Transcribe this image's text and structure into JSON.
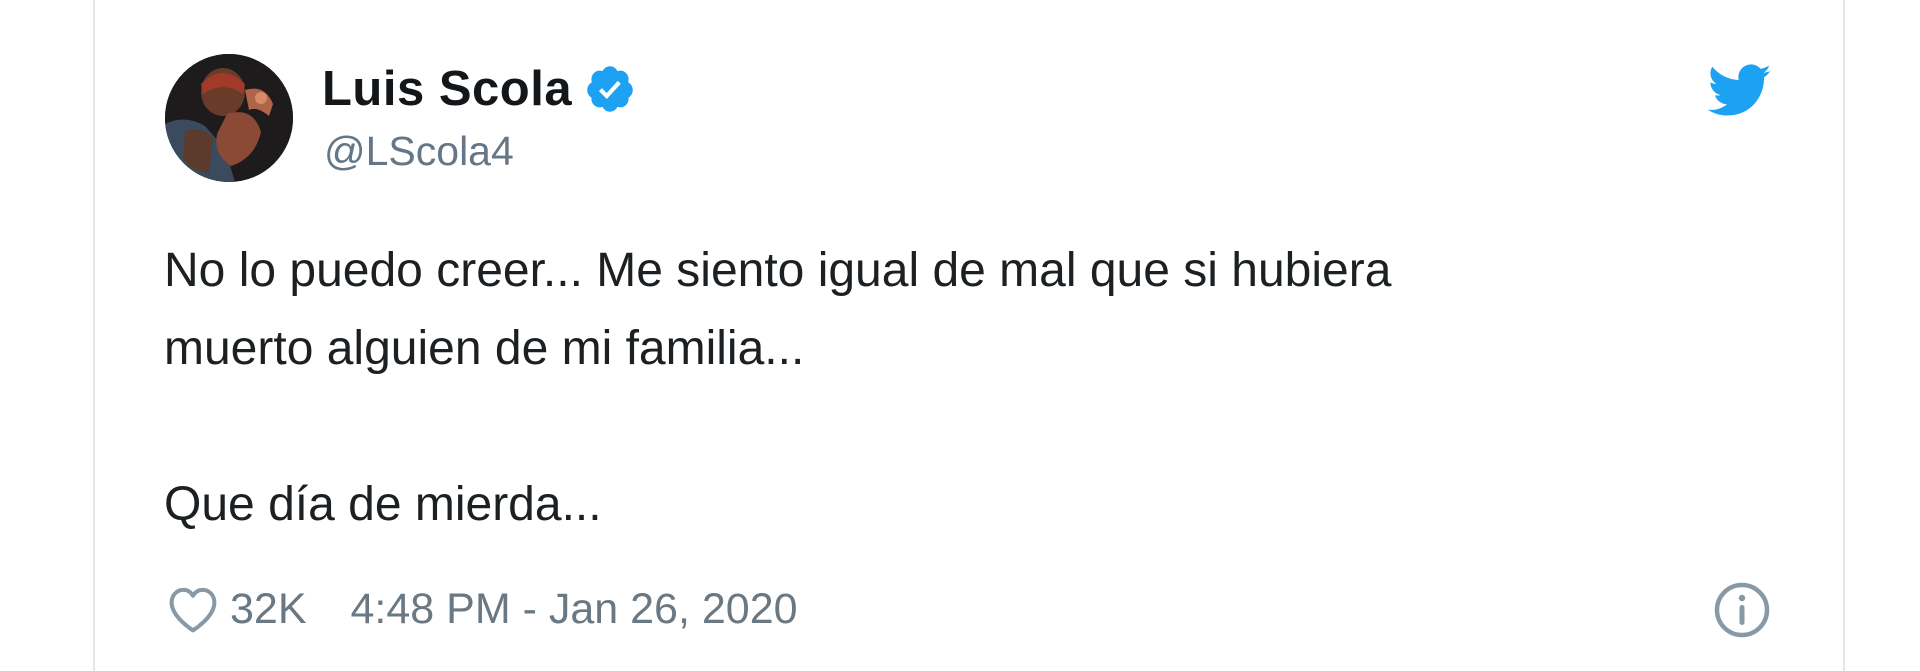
{
  "tweet": {
    "author": {
      "display_name": "Luis Scola",
      "handle": "@LScola4",
      "verified": true
    },
    "text_lines": [
      "No lo puedo creer... Me siento igual de mal que si hubiera",
      "muerto alguien de mi familia..."
    ],
    "text_line_last": "Que día de mierda...",
    "likes": "32K",
    "timestamp": "4:48 PM - Jan 26, 2020"
  },
  "icons": {
    "brand": "twitter-bird-icon",
    "verified": "verified-badge-icon",
    "like": "heart-icon",
    "info": "info-icon"
  },
  "colors": {
    "twitter_blue": "#1da1f2",
    "text_primary": "#1c2022",
    "text_secondary": "#697882",
    "border": "#e1e8ed"
  }
}
